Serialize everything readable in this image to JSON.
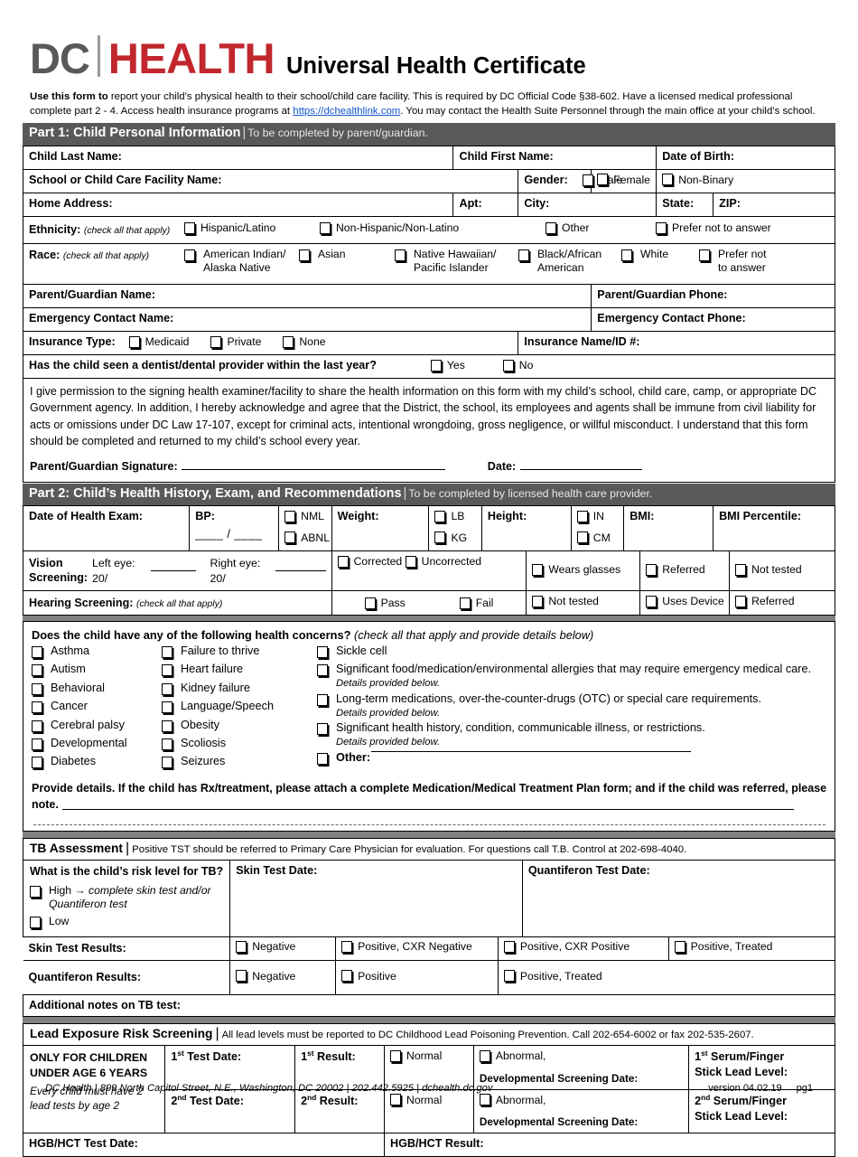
{
  "brand": {
    "dc": "DC",
    "health": "HEALTH",
    "title": "Universal Health Certificate",
    "red": "#C1272D",
    "gray": "#58595B"
  },
  "intro": {
    "lead": "Use this form to",
    "line1": " report your child’s physical health to their school/child care facility. This is required by DC Official Code §38-602. Have a licensed medical professional",
    "line2_pre": "complete part 2 - 4. Access health insurance programs at ",
    "link": "https://dchealthlink.com",
    "line2_post": ". You may contact the Health Suite Personnel through the main office at your child’s school."
  },
  "part1": {
    "bar_title": "Part 1: Child Personal Information",
    "bar_sub": "To be completed by parent/guardian.",
    "child_last_name": "Child Last Name:",
    "child_first_name": "Child First Name:",
    "date_of_birth": "Date of Birth:",
    "school_name": "School or Child Care Facility Name:",
    "gender_label": "Gender:",
    "gender_options": [
      "Male",
      "Female",
      "Non-Binary"
    ],
    "home_address": "Home Address:",
    "apt": "Apt:",
    "city": "City:",
    "state": "State:",
    "zip": "ZIP:",
    "ethnicity_label": "Ethnicity:",
    "check_all": "(check all that apply)",
    "ethnicity_options": [
      "Hispanic/Latino",
      "Non-Hispanic/Non-Latino",
      "Other",
      "Prefer not to answer"
    ],
    "race_label": "Race:",
    "race_options": [
      "American Indian/ Alaska Native",
      "Asian",
      "Native Hawaiian/ Pacific Islander",
      "Black/African American",
      "White",
      "Prefer not to answer"
    ],
    "parent_name": "Parent/Guardian Name:",
    "parent_phone": "Parent/Guardian Phone:",
    "emergency_name": "Emergency Contact Name:",
    "emergency_phone": "Emergency Contact Phone:",
    "insurance_type": "Insurance Type:",
    "insurance_options": [
      "Medicaid",
      "Private",
      "None"
    ],
    "insurance_id": "Insurance Name/ID #:",
    "dentist_question": "Has the child seen a dentist/dental provider within the last year?",
    "dentist_options": [
      "Yes",
      "No"
    ],
    "permission": "I give permission to the signing health examiner/facility to share the health information on this form with my child’s school, child care, camp, or appropriate DC Government agency. In addition, I hereby acknowledge and agree that the District, the school, its employees and agents shall be immune from civil liability for acts or omissions under DC Law 17-107, except for criminal acts, intentional wrongdoing, gross negligence, or willful misconduct. I understand that this form should be completed and returned to my child’s school every year.",
    "signature_label": "Parent/Guardian Signature:",
    "date_label": "Date:"
  },
  "part2": {
    "bar_title": "Part 2: Child’s Health History, Exam, and Recommendations",
    "bar_sub": "To be completed by licensed health care provider.",
    "exam_date": "Date of Health Exam:",
    "bp": "BP:",
    "bp_fraction": "____ / ____",
    "bp_options": [
      "NML",
      "ABNL"
    ],
    "weight": "Weight:",
    "weight_options": [
      "LB",
      "KG"
    ],
    "height": "Height:",
    "height_options": [
      "IN",
      "CM"
    ],
    "bmi": "BMI:",
    "bmi_percentile": "BMI Percentile:",
    "vision_label": "Vision Screening:",
    "vision_left": "Left eye: 20/",
    "vision_right": "Right eye: 20/",
    "vision_corr": [
      "Corrected",
      "Uncorrected"
    ],
    "vision_options": [
      "Wears glasses",
      "Referred",
      "Not tested"
    ],
    "hearing_label": "Hearing Screening:",
    "hearing_note": "(check all that apply)",
    "hearing_options": [
      "Pass",
      "Fail",
      "Not tested",
      "Uses Device",
      "Referred"
    ],
    "concerns_question": "Does the child have any of the following health concerns?",
    "concerns_note": "(check all that apply and provide details below)",
    "concerns_col1": [
      "Asthma",
      "Autism",
      "Behavioral",
      "Cancer",
      "Cerebral palsy",
      "Developmental",
      "Diabetes"
    ],
    "concerns_col2": [
      "Failure to thrive",
      "Heart failure",
      "Kidney failure",
      "Language/Speech",
      "Obesity",
      "Scoliosis",
      "Seizures"
    ],
    "concerns_col3": [
      {
        "text": "Sickle cell",
        "sub": ""
      },
      {
        "text": "Significant food/medication/environmental allergies that may require emergency medical care.",
        "sub": "Details provided below."
      },
      {
        "text": "Long-term medications, over-the-counter-drugs (OTC) or special care requirements.",
        "sub": "Details provided below."
      },
      {
        "text": "Significant health history, condition, communicable illness, or restrictions.",
        "sub": "Details provided below."
      },
      {
        "text": "Other:",
        "sub": ""
      }
    ],
    "provide_details": "Provide details. If the child has Rx/treatment, please attach a complete Medication/Medical Treatment Plan form; and if the child was referred, please note."
  },
  "tb": {
    "bar_title": "TB Assessment",
    "bar_sub": "Positive TST should be referred to Primary Care Physician for evaluation. For questions call T.B. Control at 202-698-4040.",
    "risk_question": "What is the child’s risk level for TB?",
    "high_label": "High",
    "high_arrow": "→",
    "high_note": "complete skin test and/or Quantiferon test",
    "low_label": "Low",
    "skin_test_date": "Skin Test Date:",
    "quantiferon_test_date": "Quantiferon Test Date:",
    "skin_results_label": "Skin Test Results:",
    "skin_results": [
      "Negative",
      "Positive, CXR Negative",
      "Positive, CXR Positive",
      "Positive, Treated"
    ],
    "quantiferon_results_label": "Quantiferon Results:",
    "quantiferon_results": [
      "Negative",
      "Positive",
      "Positive, Treated"
    ],
    "additional_notes": "Additional notes on TB test:"
  },
  "lead": {
    "bar_title": "Lead Exposure Risk Screening",
    "bar_sub": "All lead levels must be reported to DC Childhood Lead Poisoning Prevention. Call 202-654-6002 or fax 202-535-2607.",
    "only_line1": "ONLY FOR CHILDREN",
    "only_line2": "UNDER AGE 6 YEARS",
    "only_italic": "Every child must have 2 lead tests by age 2",
    "test1_date": "Test Date:",
    "test1_result": "Result:",
    "ord1": "st",
    "ord2": "nd",
    "num1": "1",
    "num2": "2",
    "result_options": [
      "Normal",
      "Abnormal,"
    ],
    "dev_screening": "Developmental Screening Date:",
    "serum1_line1": "Serum/Finger",
    "serum1_line2": "Stick Lead Level:",
    "hgb_date": "HGB/HCT Test Date:",
    "hgb_result": "HGB/HCT Result:"
  },
  "footer": {
    "left": "DC Health | 899 North Capitol Street, N.E., Washington, DC 20002 | 202.442.5925 | dchealth.dc.gov",
    "version": "version 04.02.19",
    "page": "pg1"
  }
}
